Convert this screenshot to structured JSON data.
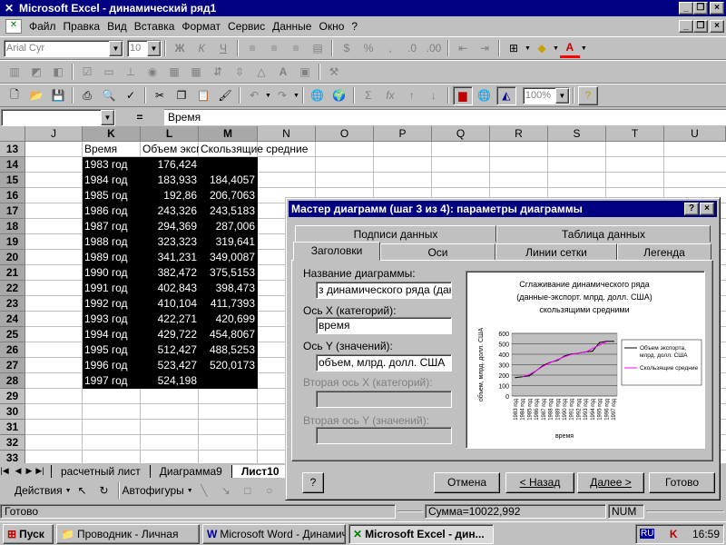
{
  "window": {
    "title": "Microsoft Excel - динамический ряд1"
  },
  "menu": [
    "Файл",
    "Правка",
    "Вид",
    "Вставка",
    "Формат",
    "Сервис",
    "Данные",
    "Окно",
    "?"
  ],
  "format_toolbar": {
    "font": "Arial Cyr",
    "size": "10",
    "bold": "Ж",
    "italic": "К",
    "underline": "Ч",
    "percent": "%",
    "thousands": ",",
    "font_color_letter": "A"
  },
  "standard_toolbar": {
    "zoom": "100%",
    "sum": "Σ",
    "function": "fx"
  },
  "formula_bar": {
    "cell_ref": "",
    "equals": "=",
    "content": "Время"
  },
  "columns": [
    "J",
    "K",
    "L",
    "M",
    "N",
    "O",
    "P",
    "Q",
    "R",
    "S",
    "T",
    "U"
  ],
  "rows": [
    "13",
    "14",
    "15",
    "16",
    "17",
    "18",
    "19",
    "20",
    "21",
    "22",
    "23",
    "24",
    "25",
    "26",
    "27",
    "28",
    "29",
    "30",
    "31",
    "32",
    "33"
  ],
  "headers": {
    "k": "Время",
    "l": "Объем экспорта",
    "m": "Скользящие средние"
  },
  "table": [
    {
      "year": "1983 год",
      "vol": "176,424",
      "ma": ""
    },
    {
      "year": "1984 год",
      "vol": "183,933",
      "ma": "184,4057"
    },
    {
      "year": "1985 год",
      "vol": "192,86",
      "ma": "206,7063"
    },
    {
      "year": "1986 год",
      "vol": "243,326",
      "ma": "243,5183"
    },
    {
      "year": "1987 год",
      "vol": "294,369",
      "ma": "287,006"
    },
    {
      "year": "1988 год",
      "vol": "323,323",
      "ma": "319,641"
    },
    {
      "year": "1989 год",
      "vol": "341,231",
      "ma": "349,0087"
    },
    {
      "year": "1990 год",
      "vol": "382,472",
      "ma": "375,5153"
    },
    {
      "year": "1991 год",
      "vol": "402,843",
      "ma": "398,473"
    },
    {
      "year": "1992 год",
      "vol": "410,104",
      "ma": "411,7393"
    },
    {
      "year": "1993 год",
      "vol": "422,271",
      "ma": "420,699"
    },
    {
      "year": "1994 год",
      "vol": "429,722",
      "ma": "454,8067"
    },
    {
      "year": "1995 год",
      "vol": "512,427",
      "ma": "488,5253"
    },
    {
      "year": "1996 год",
      "vol": "523,427",
      "ma": "520,0173"
    },
    {
      "year": "1997 год",
      "vol": "524,198",
      "ma": ""
    }
  ],
  "sheet_tabs": [
    "расчетный лист",
    "Диаграмма9",
    "Лист10"
  ],
  "drawbar": {
    "actions": "Действия",
    "autoshapes": "Автофигуры"
  },
  "status": {
    "ready": "Готово",
    "sum": "Сумма=10022,992",
    "num": "NUM"
  },
  "taskbar": {
    "start": "Пуск",
    "tasks": [
      "Проводник - Личная",
      "Microsoft Word - Динамич...",
      "Microsoft Excel - дин..."
    ],
    "lang": "RU",
    "time": "16:59"
  },
  "dialog": {
    "title": "Мастер диаграмм (шаг 3 из 4): параметры диаграммы",
    "tabs_back": [
      "Подписи данных",
      "Таблица данных"
    ],
    "tabs_front": [
      "Заголовки",
      "Оси",
      "Линии сетки",
      "Легенда"
    ],
    "fields": [
      {
        "label": "Название диаграммы:",
        "value": "з динамического ряда (данн",
        "disabled": false
      },
      {
        "label": "Ось X (категорий):",
        "value": "время",
        "disabled": false
      },
      {
        "label": "Ось Y (значений):",
        "value": "объем, млрд. долл. США",
        "disabled": false
      },
      {
        "label": "Вторая ось X (категорий):",
        "value": "",
        "disabled": true
      },
      {
        "label": "Вторая ось Y (значений):",
        "value": "",
        "disabled": true
      }
    ],
    "buttons": {
      "help": "?",
      "cancel": "Отмена",
      "back": "< Назад",
      "next": "Далее >",
      "finish": "Готово"
    }
  },
  "chart_data": {
    "type": "line",
    "title": "Сглаживание динамического ряда (данные-экспорт. млрд. долл. США) скользящими средними",
    "title_lines": [
      "Сглаживание динамического ряда",
      "(данные-экспорт. млрд. долл. США)",
      "скользящими средними"
    ],
    "xlabel": "время",
    "ylabel": "объем, млрд. долл. США",
    "categories": [
      "1983 год",
      "1984 год",
      "1985 год",
      "1986 год",
      "1987 год",
      "1988 год",
      "1989 год",
      "1990 год",
      "1991 год",
      "1992 год",
      "1993 год",
      "1994 год",
      "1995 год",
      "1996 год",
      "1997 год"
    ],
    "yticks": [
      "0",
      "100",
      "200",
      "300",
      "400",
      "500",
      "600"
    ],
    "ylim": [
      0,
      600
    ],
    "grid": true,
    "legend": "right",
    "series": [
      {
        "name": "Объем экспорта, млрд. долл. США",
        "color": "#000000",
        "values": [
          176.424,
          183.933,
          192.86,
          243.326,
          294.369,
          323.323,
          341.231,
          382.472,
          402.843,
          410.104,
          422.271,
          429.722,
          512.427,
          523.427,
          524.198
        ]
      },
      {
        "name": "Скользящие средние",
        "color": "#ff00ff",
        "values": [
          null,
          184.4057,
          206.7063,
          243.5183,
          287.006,
          319.641,
          349.0087,
          375.5153,
          398.473,
          411.7393,
          420.699,
          454.8067,
          488.5253,
          520.0173,
          null
        ]
      }
    ]
  }
}
